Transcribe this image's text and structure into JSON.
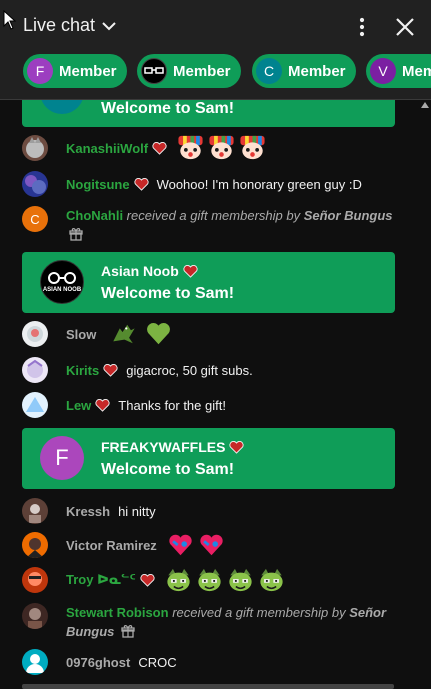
{
  "header": {
    "title": "Live chat",
    "icons": {
      "chevron": "chevron-down-icon",
      "more": "more-vert-icon",
      "close": "close-icon"
    }
  },
  "chips": [
    {
      "initial": "F",
      "label": "Member",
      "avatar_color": "#9c3ec0"
    },
    {
      "initial": "",
      "label": "Member",
      "avatar_color": "#000000"
    },
    {
      "initial": "C",
      "label": "Member",
      "avatar_color": "#00838f"
    },
    {
      "initial": "V",
      "label": "Mem",
      "avatar_color": "#7b1fa2"
    }
  ],
  "colors": {
    "accent": "#0f9d58",
    "member_name": "#2ba640",
    "plain_name": "#aaaaaa",
    "background": "#0f0f0f",
    "header": "#212121",
    "heart": "#c62828"
  },
  "chat": {
    "banner_partial": {
      "message": "Welcome to Sam!",
      "avatar_color": "#00838f"
    },
    "kanashii": {
      "name": "KanashiiWolf"
    },
    "nogitsune": {
      "name": "Nogitsune",
      "message": "Woohoo! I'm honorary green guy :D"
    },
    "chonahli": {
      "initial": "C",
      "name": "ChoNahli",
      "text": " received a gift membership by ",
      "gifter": "Señor Bungus"
    },
    "banner_asian": {
      "name": "Asian Noob",
      "message": "Welcome to Sam!",
      "avatar_text": "ASIAN NOOB"
    },
    "slow": {
      "name": "Slow"
    },
    "kirits": {
      "name": "Kirits",
      "message": "gigacroc, 50 gift subs."
    },
    "lew": {
      "name": "Lew",
      "message": "Thanks for the gift!"
    },
    "banner_freaky": {
      "initial": "F",
      "name": "FREAKYWAFFLES",
      "message": "Welcome to Sam!",
      "avatar_color": "#ab47bc"
    },
    "kressh": {
      "name": "Kressh",
      "message": "hi nitty"
    },
    "victor": {
      "name": "Victor Ramirez"
    },
    "troy": {
      "name": "Troy ᐅᓇᓪᑦ"
    },
    "stewart": {
      "name": "Stewart Robison",
      "text": " received a gift membership by ",
      "gifter": "Señor Bungus"
    },
    "ghost": {
      "name": "0976ghost",
      "message": "CROC"
    }
  }
}
